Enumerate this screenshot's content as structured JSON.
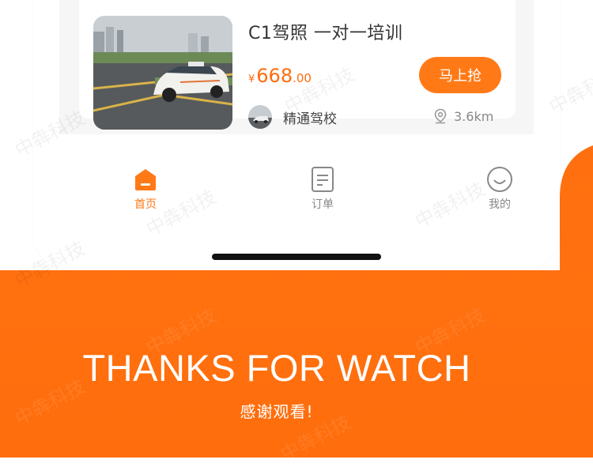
{
  "colors": {
    "accent": "#ff7a17",
    "price": "#ff6b0d",
    "backdrop": "#ff6f0f"
  },
  "course": {
    "title": "C1驾照 一对一培训",
    "price_currency": "¥",
    "price_integer": "668",
    "price_decimal": ".00",
    "buy_label": "马上抢",
    "school_name": "精通驾校",
    "distance": "3.6km"
  },
  "tabs": [
    {
      "label": "首页",
      "icon": "home-icon",
      "active": true
    },
    {
      "label": "订单",
      "icon": "order-document-icon",
      "active": false
    },
    {
      "label": "我的",
      "icon": "smiley-profile-icon",
      "active": false
    }
  ],
  "closing": {
    "title": "THANKS FOR WATCH",
    "subtitle": "感谢观看!"
  },
  "watermark": "中犇科技"
}
